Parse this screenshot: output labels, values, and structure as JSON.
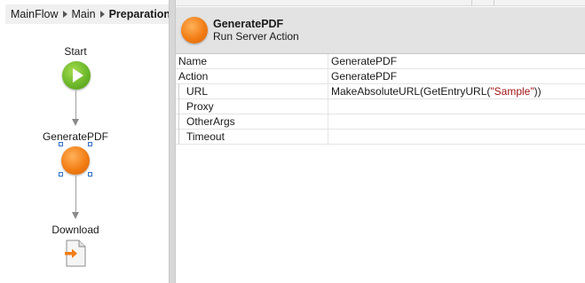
{
  "breadcrumb": {
    "items": [
      "MainFlow",
      "Main"
    ],
    "current": "Preparation"
  },
  "flow": {
    "start_label": "Start",
    "action_label": "GeneratePDF",
    "download_label": "Download"
  },
  "header": {
    "title": "GeneratePDF",
    "subtitle": "Run Server Action"
  },
  "properties": [
    {
      "name": "Name",
      "value": "GeneratePDF"
    },
    {
      "name": "Action",
      "value": "GeneratePDF"
    },
    {
      "name": "URL",
      "value_prefix": "MakeAbsoluteURL(GetEntryURL(",
      "value_literal": "\"Sample\"",
      "value_suffix": "))"
    },
    {
      "name": "Proxy",
      "value": ""
    },
    {
      "name": "OtherArgs",
      "value": ""
    },
    {
      "name": "Timeout",
      "value": ""
    }
  ],
  "colors": {
    "start_green": "#6cb82a",
    "action_orange": "#f27d14",
    "string_literal": "#a31515",
    "selection_handle": "#2d6fc4"
  },
  "icons": {
    "start": "play-icon",
    "action": "server-action-icon",
    "download": "download-icon"
  }
}
